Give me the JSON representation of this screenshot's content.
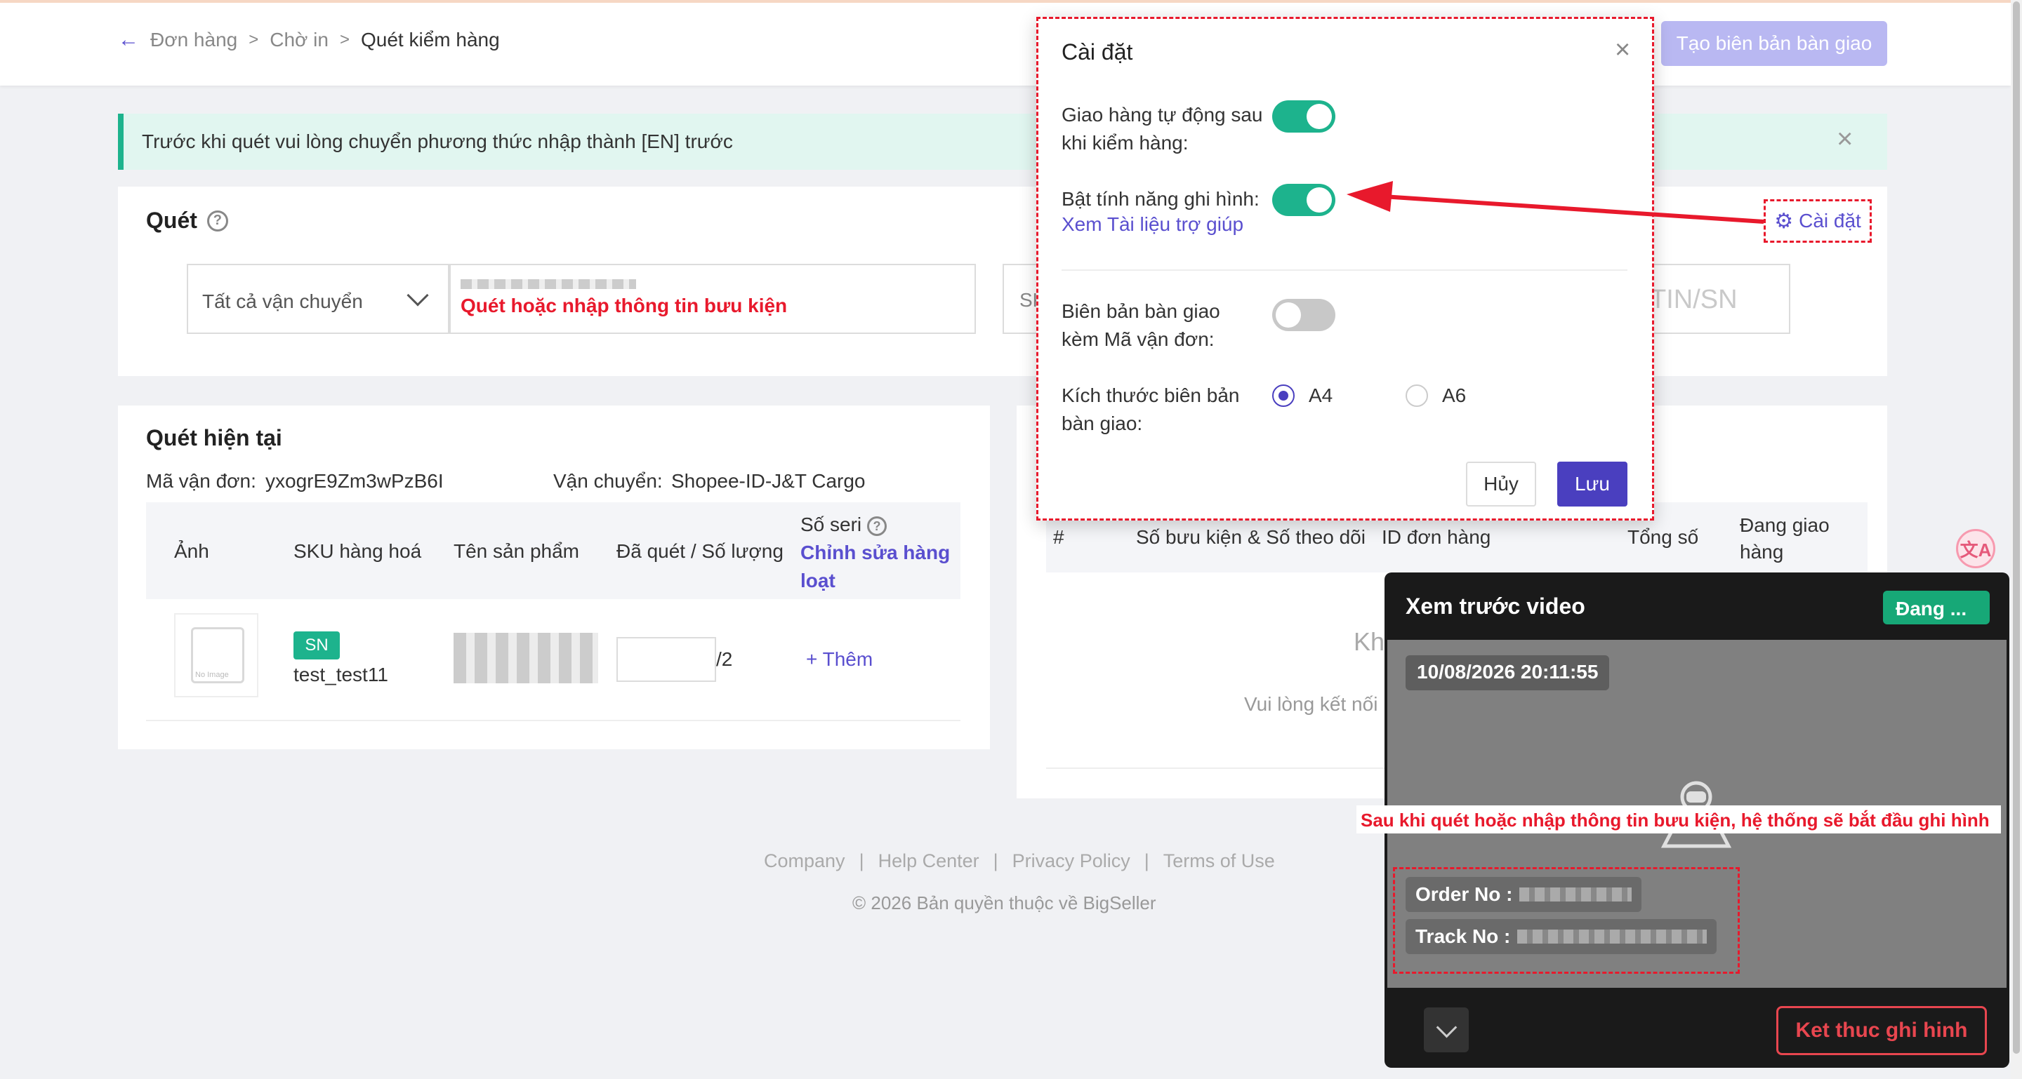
{
  "breadcrumb": {
    "items": [
      "Đơn hàng",
      "Chờ in",
      "Quét kiểm hàng"
    ]
  },
  "header": {
    "create_button": "Tạo biên bản bàn giao"
  },
  "notice": {
    "text": "Trước khi quét vui lòng chuyển phương thức nhập thành [EN] trước"
  },
  "scan": {
    "title": "Quét",
    "carrier_select": "Tất cả vận chuyển",
    "input_hint": "Quét hoặc nhập thông tin bưu kiện",
    "sku_partial": "SK",
    "imei_placeholder": "TIN/SN",
    "settings_link": "Cài đặt"
  },
  "current": {
    "title": "Quét hiện tại",
    "order_label": "Mã vận đơn:",
    "order_value": "yxogrE9Zm3wPzB6I",
    "carrier_label": "Vận chuyển:",
    "carrier_value": "Shopee-ID-J&T Cargo",
    "columns": {
      "image": "Ảnh",
      "sku": "SKU hàng hoá",
      "name": "Tên sản phẩm",
      "scanned": "Đã quét / Số lượng",
      "serial": "Số seri",
      "serial_edit_1": "Chỉnh sửa hàng",
      "serial_edit_2": "loạt"
    },
    "row": {
      "image_text": "No Image",
      "badge": "SN",
      "sku": "test_test11",
      "qty_total": "/2",
      "add": "+ Thêm"
    }
  },
  "right": {
    "columns": {
      "num": "#",
      "parcel": "Số bưu kiện & Số theo dõi",
      "order_id": "ID đơn hàng",
      "total": "Tổng số",
      "shipping_1": "Đang giao",
      "shipping_2": "hàng"
    },
    "empty_title": "Kh",
    "empty_hint": "Vui lòng kết nối"
  },
  "footer": {
    "links": [
      "Company",
      "Help Center",
      "Privacy Policy",
      "Terms of Use"
    ],
    "separator": "|",
    "copyright": "© 2026 Bản quyền thuộc về BigSeller"
  },
  "modal": {
    "title": "Cài đặt",
    "auto_ship_1": "Giao hàng tự động sau",
    "auto_ship_2": "khi kiểm hàng:",
    "recording": "Bật tính năng ghi hình:",
    "help_link": "Xem Tài liệu trợ giúp",
    "handover_1": "Biên bản bàn giao",
    "handover_2": "kèm Mã vận đơn:",
    "size_1": "Kích thước biên bản",
    "size_2": "bàn giao:",
    "size_a4": "A4",
    "size_a6": "A6",
    "cancel": "Hủy",
    "save": "Lưu",
    "toggles": {
      "auto_ship": true,
      "recording": true,
      "handover": false
    },
    "selected_size": "A4"
  },
  "video": {
    "title": "Xem trước video",
    "status": "Đang ...",
    "timestamp": "10/08/2026 20:11:55",
    "caption": "Sau khi quét hoặc nhập thông tin bưu kiện, hệ thống sẽ bắt đầu ghi hình",
    "order_label": "Order No :",
    "track_label": "Track No :",
    "end_button": "Ket thuc ghi hinh"
  },
  "floating": {
    "icon_text": "文A"
  },
  "colors": {
    "accent": "#5a4fcf",
    "primary_button": "#4a3fbf",
    "success": "#1db38d",
    "alert_red": "#e8192c"
  }
}
